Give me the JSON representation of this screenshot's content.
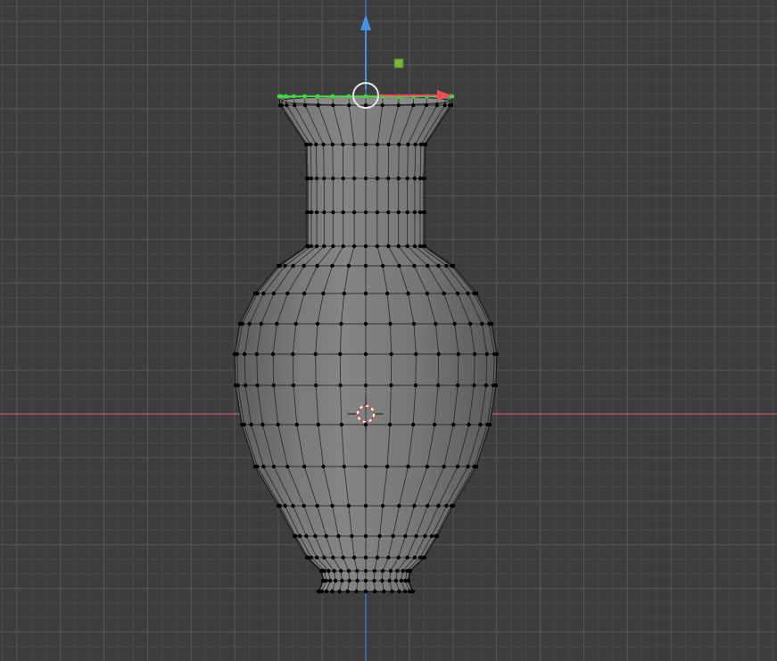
{
  "viewport": {
    "view": "front-orthographic",
    "mode": "edit-mode-vertex",
    "mesh": "vase",
    "colors": {
      "background": "#3d3d3d",
      "grid_minor": "#474747",
      "grid_major": "#555555",
      "x_axis": "#d05c6a",
      "z_axis": "#3d84d6",
      "mesh_fill": "#777777",
      "mesh_edge": "#1a1a1a",
      "vertex": "#000000",
      "selected": "#3ddb3d",
      "gizmo_x": "#ef4f55",
      "gizmo_z": "#4a8fe6",
      "gizmo_plane": "#7fb33e"
    },
    "icons": {
      "gizmo": "move-gizmo-icon",
      "cursor": "3d-cursor-icon",
      "center": "pivot-circle-icon"
    },
    "selection": {
      "selected_ring": "top-rim"
    }
  }
}
